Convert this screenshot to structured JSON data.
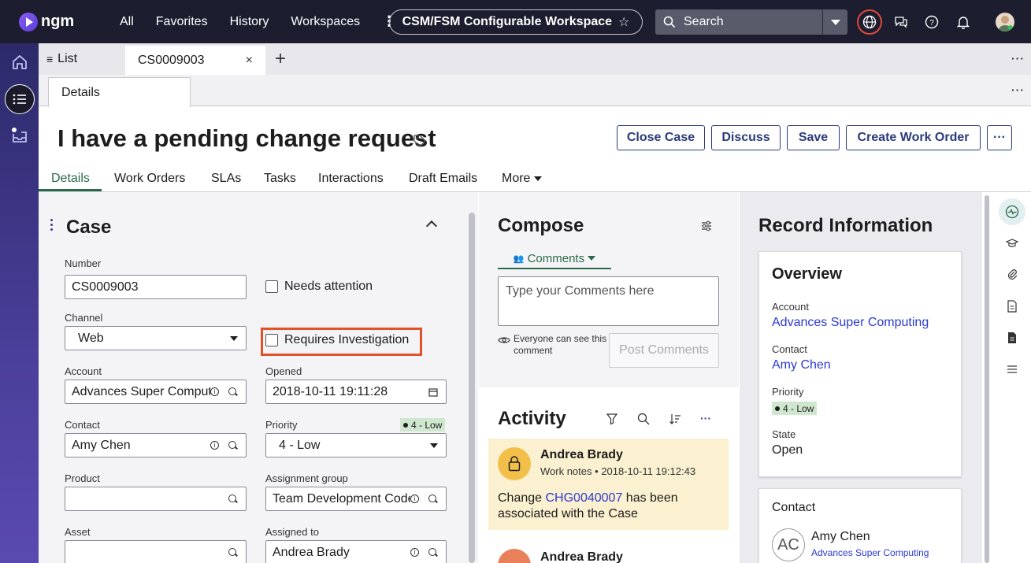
{
  "topbar": {
    "logo_text": "ngm",
    "nav": [
      "All",
      "Favorites",
      "History",
      "Workspaces"
    ],
    "workspace_title": "CSM/FSM Configurable Workspace",
    "search_label": "Search"
  },
  "tabs": {
    "list_label": "List",
    "active_tab": "CS0009003"
  },
  "subtab": "Details",
  "header": {
    "title": "I have a pending change request",
    "buttons": [
      "Close Case",
      "Discuss",
      "Save",
      "Create Work Order"
    ]
  },
  "form_tabs": [
    "Details",
    "Work Orders",
    "SLAs",
    "Tasks",
    "Interactions",
    "Draft Emails",
    "More"
  ],
  "case": {
    "heading": "Case",
    "number_label": "Number",
    "number_value": "CS0009003",
    "needs_attention_label": "Needs attention",
    "channel_label": "Channel",
    "channel_value": "Web",
    "requires_investigation_label": "Requires Investigation",
    "account_label": "Account",
    "account_value": "Advances Super Computing",
    "opened_label": "Opened",
    "opened_value": "2018-10-11 19:11:28",
    "contact_label": "Contact",
    "contact_value": "Amy Chen",
    "priority_label": "Priority",
    "priority_value": "4 - Low",
    "priority_badge": "4 - Low",
    "product_label": "Product",
    "product_value": "",
    "assignment_group_label": "Assignment group",
    "assignment_group_value": "Team Development Code Reviewers",
    "asset_label": "Asset",
    "asset_value": "",
    "assigned_to_label": "Assigned to",
    "assigned_to_value": "Andrea Brady"
  },
  "compose": {
    "heading": "Compose",
    "tab_label": "Comments",
    "placeholder": "Type your Comments here",
    "visibility_note": "Everyone can see this comment",
    "post_label": "Post Comments"
  },
  "activity": {
    "heading": "Activity",
    "items": [
      {
        "author": "Andrea Brady",
        "type": "Work notes",
        "time": "2018-10-11 19:12:43",
        "text_before": "Change ",
        "link": "CHG0040007",
        "text_after": " has been associated with the Case"
      },
      {
        "author": "Andrea Brady"
      }
    ]
  },
  "record": {
    "heading": "Record Information",
    "overview_heading": "Overview",
    "account_label": "Account",
    "account_value": "Advances Super Computing",
    "contact_label": "Contact",
    "contact_value": "Amy Chen",
    "priority_label": "Priority",
    "priority_value": "4 - Low",
    "state_label": "State",
    "state_value": "Open",
    "contact_card_heading": "Contact",
    "contact_initials": "AC",
    "contact_name": "Amy Chen",
    "contact_company": "Advances Super Computing"
  },
  "colors": {
    "topbar": "#1c1d2e",
    "accent_green": "#2a6a4a",
    "link_blue": "#2a3ad0",
    "highlight_orange": "#e0522a",
    "priority_badge": "#cfe7cf",
    "activity_card": "#fbf0cf"
  }
}
